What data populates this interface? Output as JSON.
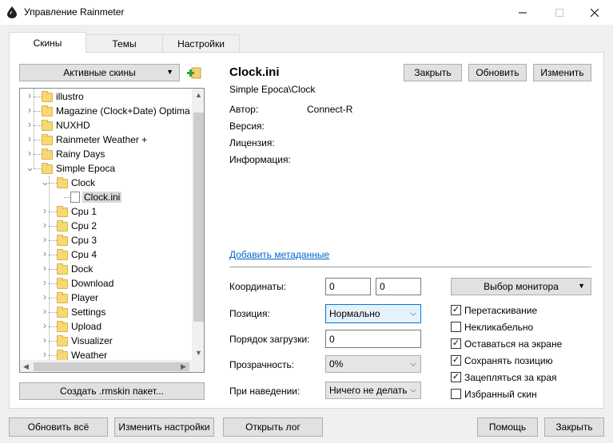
{
  "window": {
    "title": "Управление Rainmeter"
  },
  "tabs": [
    "Скины",
    "Темы",
    "Настройки"
  ],
  "skins_panel": {
    "active_skins_button": "Активные скины",
    "tree": [
      "illustro",
      "Magazine (Clock+Date) Optima",
      "NUXHD",
      "Rainmeter Weather +",
      "Rainy Days",
      "Simple Epoca",
      "Clock",
      "Clock.ini",
      "Cpu 1",
      "Cpu 2",
      "Cpu 3",
      "Cpu 4",
      "Dock",
      "Download",
      "Player",
      "Settings",
      "Upload",
      "Visualizer",
      "Weather"
    ],
    "create_package_button": "Создать .rmskin пакет..."
  },
  "skin_info": {
    "name": "Clock.ini",
    "path": "Simple Epoca\\Clock",
    "close_button": "Закрыть",
    "refresh_button": "Обновить",
    "edit_button": "Изменить",
    "author_label": "Автор:",
    "author_value": "Connect-R",
    "version_label": "Версия:",
    "license_label": "Лицензия:",
    "info_label": "Информация:",
    "add_metadata_link": "Добавить метаданные"
  },
  "settings": {
    "coords_label": "Координаты:",
    "coord_x": "0",
    "coord_y": "0",
    "position_label": "Позиция:",
    "position_value": "Нормально",
    "load_order_label": "Порядок загрузки:",
    "load_order_value": "0",
    "transparency_label": "Прозрачность:",
    "transparency_value": "0%",
    "on_hover_label": "При наведении:",
    "on_hover_value": "Ничего не делать",
    "monitor_button": "Выбор монитора",
    "checkboxes": [
      {
        "label": "Перетаскивание",
        "checked": true
      },
      {
        "label": "Некликабельно",
        "checked": false
      },
      {
        "label": "Оставаться на экране",
        "checked": true
      },
      {
        "label": "Сохранять позицию",
        "checked": true
      },
      {
        "label": "Зацепляться за края",
        "checked": true
      },
      {
        "label": "Избранный скин",
        "checked": false
      }
    ]
  },
  "bottom": {
    "refresh_all": "Обновить всё",
    "edit_settings": "Изменить настройки",
    "open_log": "Открыть лог",
    "help": "Помощь",
    "close": "Закрыть"
  },
  "colors": {
    "accent": "#0078d7",
    "link": "#0066cc",
    "folder": "#f8d775"
  }
}
